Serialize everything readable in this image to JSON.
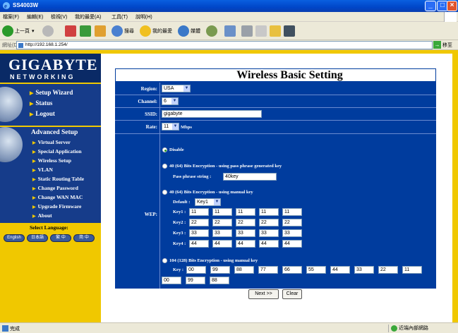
{
  "window": {
    "title": "SS4003W"
  },
  "menu": [
    "檔案(F)",
    "編輯(E)",
    "檢視(V)",
    "我的最愛(A)",
    "工具(T)",
    "說明(H)"
  ],
  "toolbar": {
    "back": "上一頁",
    "search": "搜尋",
    "favorites": "我的最愛",
    "media": "媒體"
  },
  "address": {
    "label": "網址(D)",
    "url": "http://192.168.1.254/",
    "go": "移至"
  },
  "brand": {
    "name": "GIGABYTE",
    "sub": "NETWORKING"
  },
  "nav": {
    "top": [
      "Setup Wizard",
      "Status",
      "Logout"
    ],
    "advanced_title": "Advanced Setup",
    "advanced": [
      "Virtual Server",
      "Special Application",
      "Wireless Setup",
      "VLAN",
      "Static Routing Table",
      "Change Password",
      "Change WAN MAC",
      "Upgrade Firmware",
      "About"
    ]
  },
  "language": {
    "label": "Select Language:",
    "buttons": [
      "English",
      "日本語",
      "繁 中",
      "简 中"
    ]
  },
  "page": {
    "title": "Wireless Basic Setting"
  },
  "form": {
    "region_label": "Region:",
    "region": "USA",
    "channel_label": "Channel:",
    "channel": "6",
    "ssid_label": "SSID:",
    "ssid": "gigabyte",
    "rate_label": "Rate:",
    "rate": "11",
    "rate_unit": "Mbps",
    "wep_label": "WEP:",
    "disable": "Disable",
    "opt_passphrase": "40 (64) Bits Encryption - using pass phrase generated key",
    "passphrase_label": "Pass phrase string :",
    "passphrase": "40key",
    "opt_manual40": "40 (64) Bits Encryption - using manual key",
    "default_label": "Default :",
    "default_key": "Key1",
    "keys40": [
      {
        "label": "Key1 :",
        "vals": [
          "11",
          "11",
          "11",
          "11",
          "11"
        ]
      },
      {
        "label": "Key2 :",
        "vals": [
          "22",
          "22",
          "22",
          "22",
          "22"
        ]
      },
      {
        "label": "Key3 :",
        "vals": [
          "33",
          "33",
          "33",
          "33",
          "33"
        ]
      },
      {
        "label": "Key4 :",
        "vals": [
          "44",
          "44",
          "44",
          "44",
          "44"
        ]
      }
    ],
    "opt_manual104": "104 (128) Bits Encryption - using manual key",
    "key104_label": "Key :",
    "key104": [
      "00",
      "99",
      "88",
      "77",
      "66",
      "55",
      "44",
      "33",
      "22",
      "11",
      "00",
      "99",
      "88"
    ],
    "next": "Next >>",
    "clear": "Clear"
  },
  "status": {
    "text": "完成",
    "zone": "近端內部網路"
  }
}
